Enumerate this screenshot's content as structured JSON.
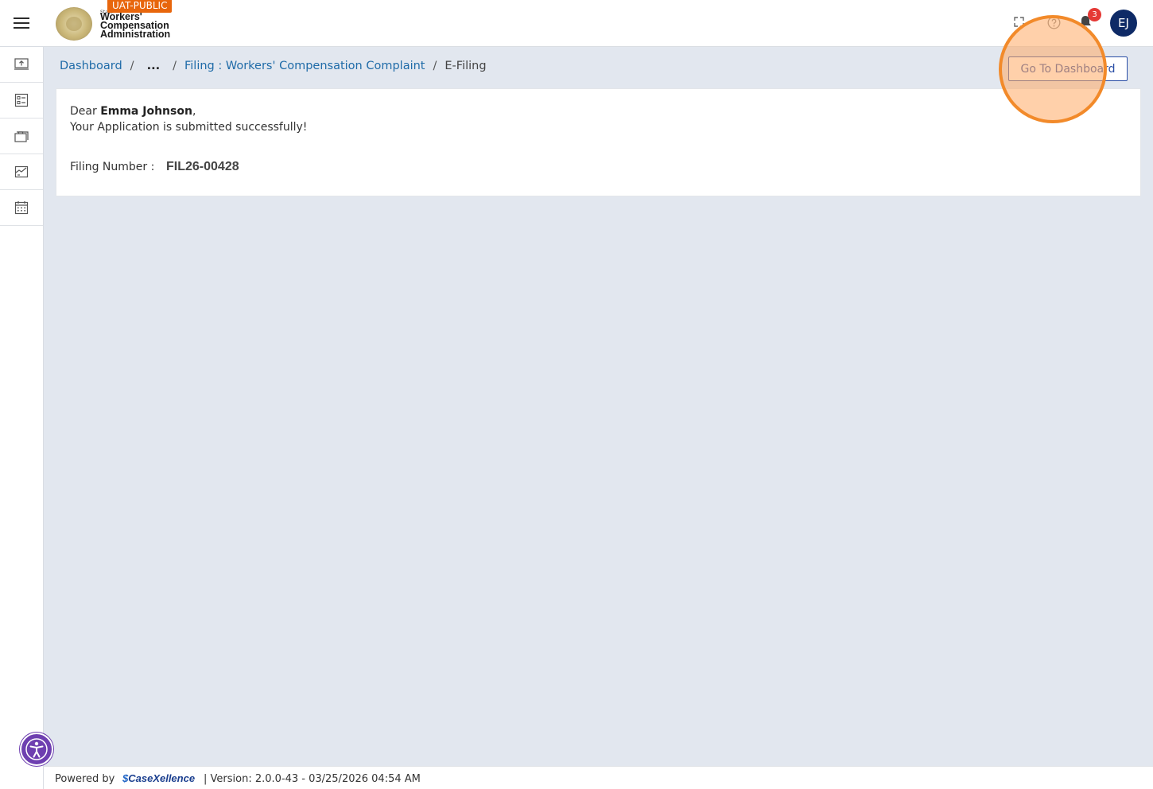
{
  "header": {
    "env_badge": "UAT-PUBLIC",
    "logo_small": "State",
    "logo_line1": "Workers'",
    "logo_line2": "Compensation",
    "logo_line3": "Administration",
    "notification_count": "3",
    "avatar_initials": "EJ"
  },
  "sidebar": {
    "items": [
      {
        "icon": "upload-monitor-icon"
      },
      {
        "icon": "checklist-icon"
      },
      {
        "icon": "briefcase-stack-icon"
      },
      {
        "icon": "chart-card-icon"
      },
      {
        "icon": "calendar-icon"
      }
    ]
  },
  "breadcrumb": {
    "home": "Dashboard",
    "sep": "/",
    "ellipsis": "...",
    "filing": "Filing : Workers' Compensation Complaint",
    "current": "E-Filing"
  },
  "actions": {
    "goto_dashboard": "Go To Dashboard"
  },
  "message": {
    "dear_prefix": "Dear ",
    "name": "Emma Johnson",
    "dear_suffix": ",",
    "success": "Your Application is submitted successfully!",
    "filing_label": "Filing Number :",
    "filing_number": "FIL26-00428"
  },
  "footer": {
    "powered_by": "Powered by",
    "brand": "CaseXellence",
    "version": "|   Version: 2.0.0-43 - 03/25/2026 04:54 AM"
  },
  "colors": {
    "accent": "#2a4ea6",
    "badge": "#e8660c",
    "avatar": "#0e2a66",
    "highlight": "#f28a2a"
  }
}
